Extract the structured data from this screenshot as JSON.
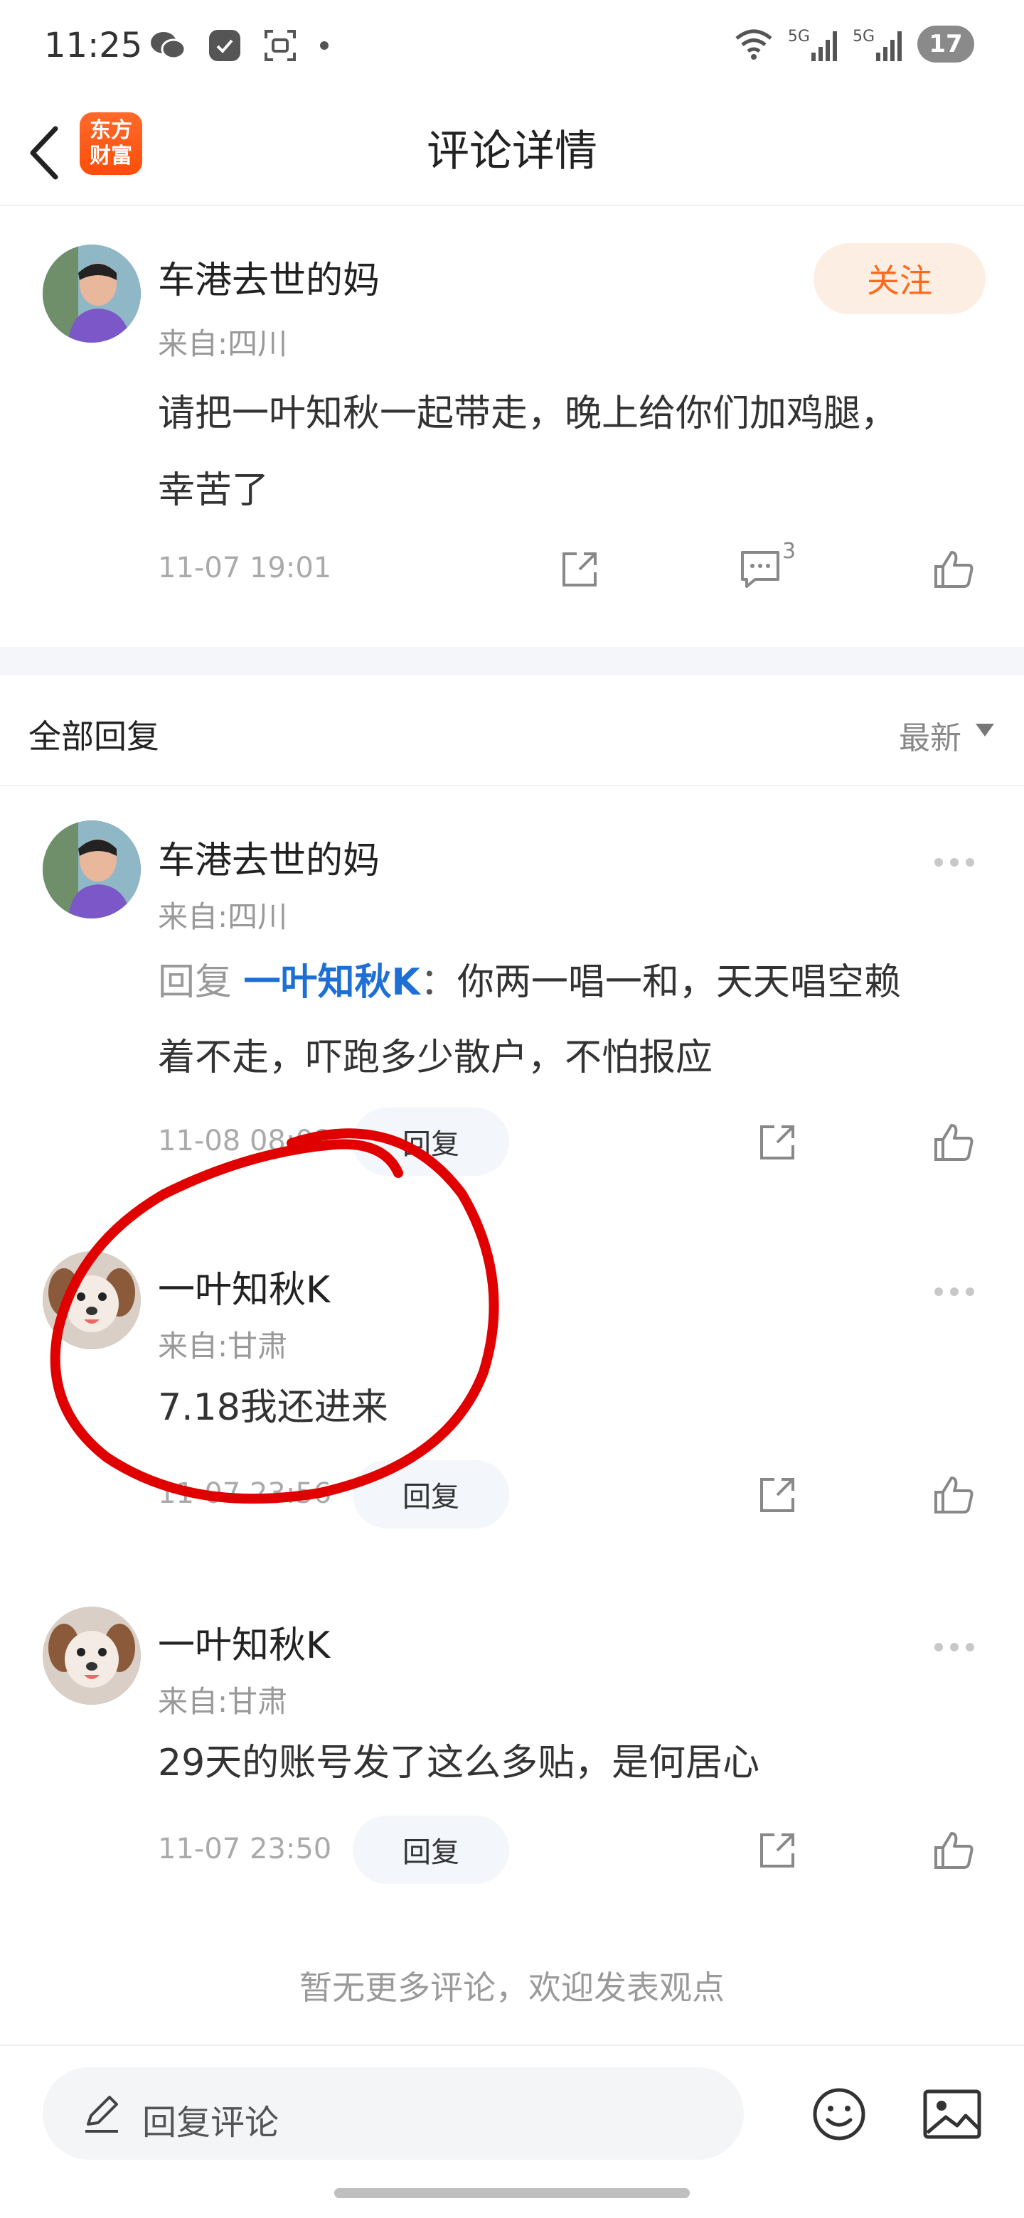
{
  "status_bar": {
    "time": "11:25",
    "network_1": "5G",
    "network_2": "5G",
    "battery": "17"
  },
  "header": {
    "logo_line1": "东方",
    "logo_line2": "财富",
    "title": "评论详情"
  },
  "main_comment": {
    "username": "车港去世的妈",
    "location": "来自:四川",
    "follow_label": "关注",
    "content_line1": "请把一叶知秋一起带走，晚上给你们加鸡腿，",
    "content_line2": "幸苦了",
    "timestamp": "11-07 19:01",
    "comment_count": "3"
  },
  "replies_header": {
    "title": "全部回复",
    "sort": "最新"
  },
  "replies": [
    {
      "username": "车港去世的妈",
      "location": "来自:四川",
      "reply_prefix": "回复 ",
      "reply_target": "一叶知秋K",
      "reply_colon": "：",
      "content_line1": "你两一唱一和，天天唱空赖",
      "content_line2": "着不走，吓跑多少散户，不怕报应",
      "timestamp": "11-08 08:08",
      "reply_label": "回复"
    },
    {
      "username": "一叶知秋K",
      "location": "来自:甘肃",
      "content_line1": "7.18我还进来",
      "timestamp": "11-07 23:56",
      "reply_label": "回复"
    },
    {
      "username": "一叶知秋K",
      "location": "来自:甘肃",
      "content_line1": "29天的账号发了这么多贴，是何居心",
      "timestamp": "11-07 23:50",
      "reply_label": "回复"
    }
  ],
  "footer": {
    "no_more": "暂无更多评论，欢迎发表观点"
  },
  "bottom_bar": {
    "input_placeholder": "回复评论"
  },
  "colors": {
    "accent": "#ff6a1a",
    "link": "#1d6fd6",
    "annotation": "#e00000"
  }
}
